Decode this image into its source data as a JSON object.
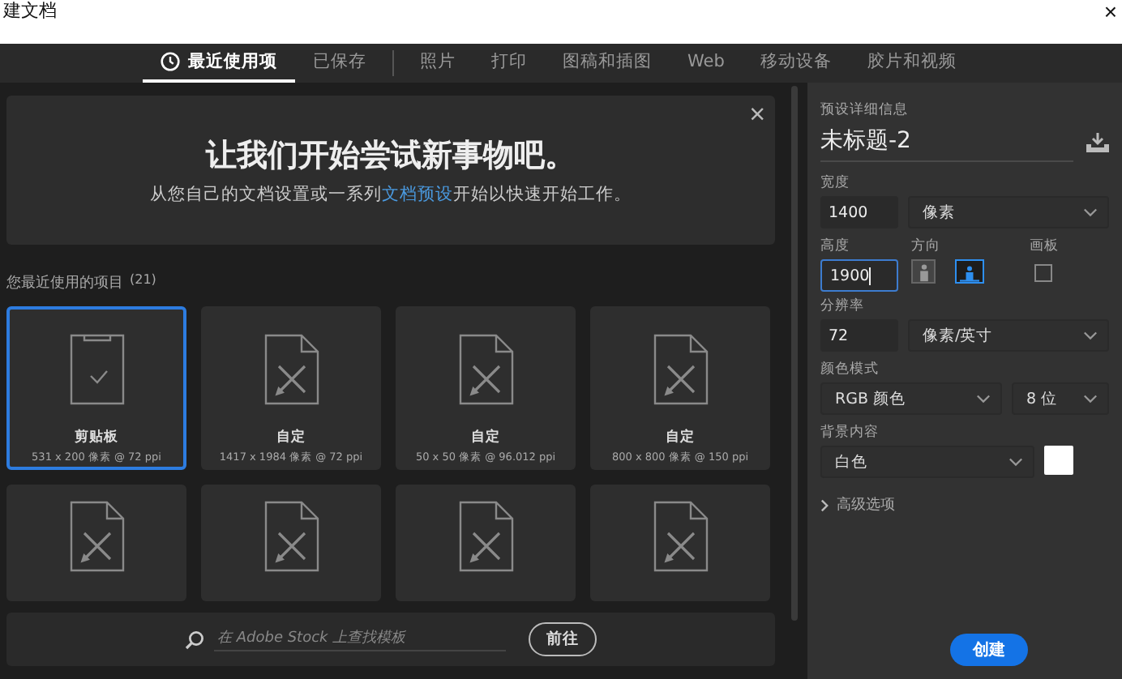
{
  "window": {
    "title": "建文档",
    "close": "×"
  },
  "tab_groups": [
    [
      {
        "label": "最近使用项",
        "selected": true,
        "icon": true
      },
      {
        "label": "已保存",
        "selected": false
      }
    ],
    [
      {
        "label": "照片",
        "selected": false
      },
      {
        "label": "打印",
        "selected": false
      },
      {
        "label": "图稿和插图",
        "selected": false
      },
      {
        "label": "Web",
        "selected": false
      },
      {
        "label": "移动设备",
        "selected": false
      },
      {
        "label": "胶片和视频",
        "selected": false
      }
    ]
  ],
  "banner": {
    "close": "×",
    "heading": "让我们开始尝试新事物吧。",
    "text_before": "从您自己的文档设置或一系列",
    "link": "文档预设",
    "text_after": "开始以快速开始工作。"
  },
  "recent": {
    "title": "您最近使用的项目",
    "count": "(21)",
    "items": [
      {
        "kind": "clipboard",
        "name": "剪贴板",
        "size": "531 x 200 像素 @ 72 ppi",
        "selected": true
      },
      {
        "kind": "custom",
        "name": "自定",
        "size": "1417 x 1984 像素 @ 72 ppi",
        "selected": false
      },
      {
        "kind": "custom",
        "name": "自定",
        "size": "50 x 50 像素 @ 96.012 ppi",
        "selected": false
      },
      {
        "kind": "custom",
        "name": "自定",
        "size": "800 x 800 像素 @ 150 ppi",
        "selected": false
      },
      {
        "kind": "custom",
        "selected": false
      },
      {
        "kind": "custom",
        "selected": false
      },
      {
        "kind": "custom",
        "selected": false
      },
      {
        "kind": "custom",
        "selected": false
      }
    ]
  },
  "stock_search": {
    "placeholder": "在 Adobe Stock 上查找模板",
    "button": "前往"
  },
  "details": {
    "heading": "预设详细信息",
    "doc_name": "未标题-2",
    "width": {
      "label": "宽度",
      "value": "1400",
      "unit": "像素"
    },
    "height": {
      "label": "高度",
      "value": "1900"
    },
    "orientation": {
      "label": "方向",
      "options": [
        {
          "kind": "portrait",
          "selected": false
        },
        {
          "kind": "landscape",
          "selected": true
        }
      ]
    },
    "artboard": {
      "label": "画板",
      "checked": false
    },
    "resolution": {
      "label": "分辨率",
      "value": "72",
      "unit": "像素/英寸"
    },
    "color_mode": {
      "label": "颜色模式",
      "mode": "RGB 颜色",
      "depth": "8 位"
    },
    "background": {
      "label": "背景内容",
      "value": "白色",
      "color": "#ffffff"
    },
    "advanced": "高级选项",
    "create": "创建"
  }
}
